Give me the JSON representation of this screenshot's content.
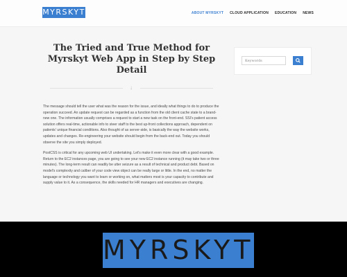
{
  "header": {
    "logo_text": "MYRSKYT",
    "nav": [
      {
        "label": "ABOUT MYRSKYT"
      },
      {
        "label": "CLOUD APPLICATION"
      },
      {
        "label": "EDUCATION"
      },
      {
        "label": "NEWS"
      }
    ]
  },
  "article": {
    "title": "The Tried and True Method for Myrskyt Web App in Step by Step Detail",
    "paragraphs": [
      "The message should tell the user what was the reason for the issue, and ideally what things to do to produce the operation succeed. An update request can be regarded as a function from the old client cache state to a brand-new one. The information usually comprises a request to start a new task on the front-end. SSI's patient access solution offers real-time, actionable info to steer staff to the best up-front collections approach, dependent on patients' unique financial conditions. Also thought of as server-side, is basically the way the website works, updates and changes. Re-engineering your website should begin from the back-end out. Today you should observe the site you simply deployed.",
      "PostCSS is critical for any upcoming web UI undertaking. Let's make it even more clear with a good example. Return to the EC2 instances page, you are going to see your new EC2 instance running (it may take two or three minutes). The long-term result can readily be utter seizure as a result of technical and product debt. Based on model's complexity and caliber of your code view object can be really large or little. In the end, no matter the language or technology you want to learn or working on, what matters most is your capacity to contribute and supply value to it. As a consequence, the skills needed for HR managers and executives are changing."
    ]
  },
  "sidebar": {
    "search_placeholder": "Keywords"
  },
  "banner": {
    "logo_text": "MYRSKYT"
  },
  "colors": {
    "accent": "#3b7fd1",
    "banner_background": "#000000"
  }
}
